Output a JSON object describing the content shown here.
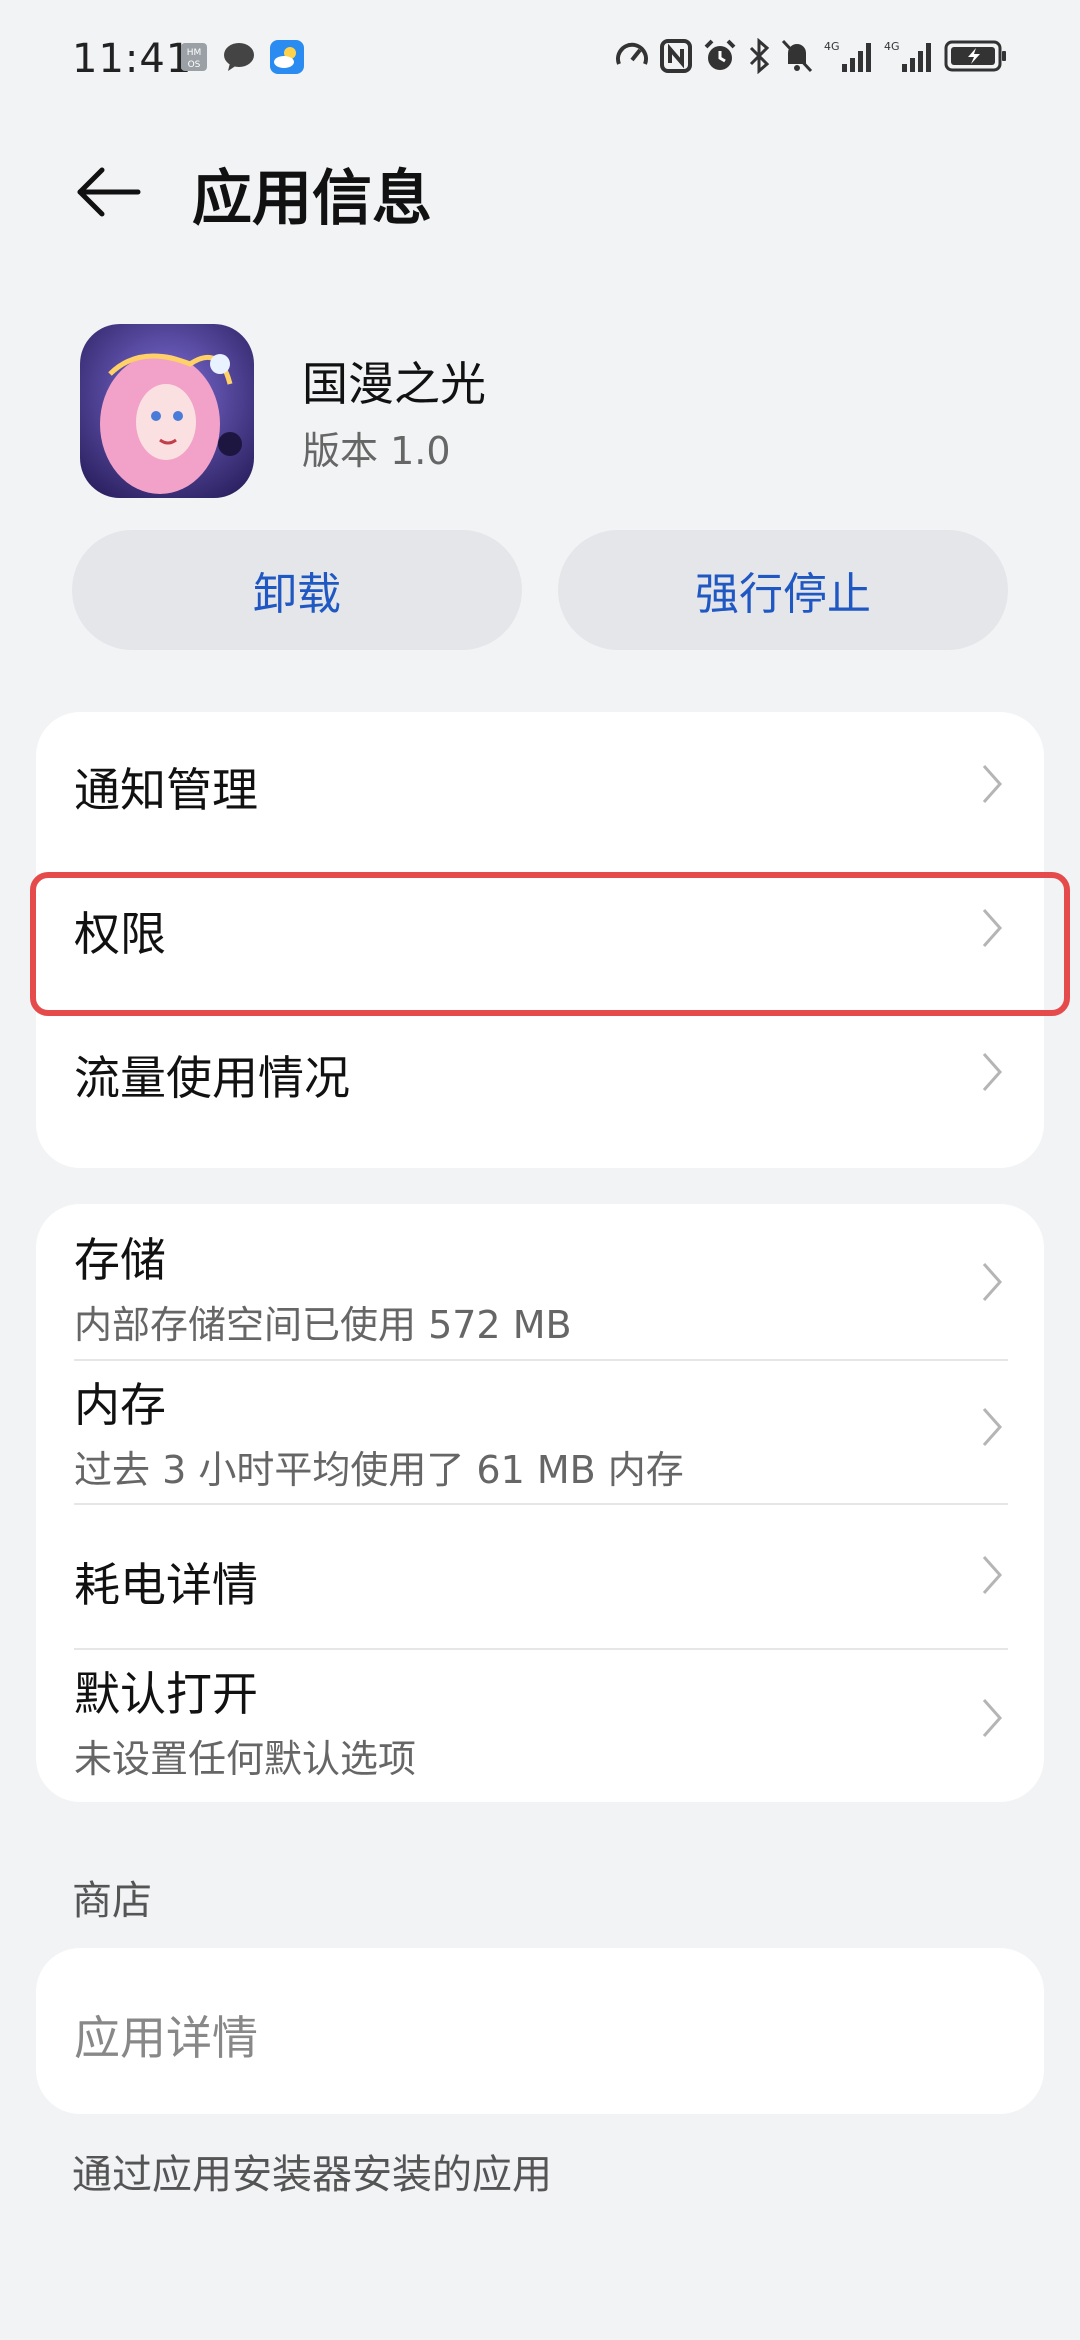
{
  "status_bar": {
    "time": "11:41",
    "left_icons": [
      "hmos-icon",
      "chat-bubble-icon",
      "weather-icon"
    ],
    "right_icons": [
      "speedometer-icon",
      "nfc-icon",
      "alarm-icon",
      "bluetooth-icon",
      "silent-bell-icon",
      "signal-4g-icon",
      "signal-4g-icon",
      "battery-charging-icon"
    ]
  },
  "header": {
    "title": "应用信息"
  },
  "app": {
    "name": "国漫之光",
    "version": "版本 1.0"
  },
  "actions": {
    "uninstall": "卸载",
    "force_stop": "强行停止"
  },
  "group1": {
    "items": [
      {
        "label": "通知管理"
      },
      {
        "label": "权限"
      },
      {
        "label": "流量使用情况"
      }
    ]
  },
  "group2": {
    "items": [
      {
        "label": "存储",
        "sub": "内部存储空间已使用 572 MB"
      },
      {
        "label": "内存",
        "sub": "过去 3 小时平均使用了 61 MB 内存"
      },
      {
        "label": "耗电详情"
      },
      {
        "label": "默认打开",
        "sub": "未设置任何默认选项"
      }
    ]
  },
  "store": {
    "section_title": "商店",
    "app_details": "应用详情"
  },
  "footer": {
    "note": "通过应用安装器安装的应用"
  },
  "colors": {
    "accent": "#1f57c3",
    "highlight": "#e54b4b",
    "background": "#f1f3f5"
  }
}
